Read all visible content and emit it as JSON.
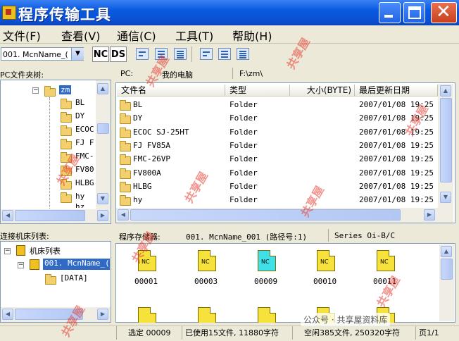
{
  "window": {
    "title": "程序传输工具"
  },
  "menu": [
    "文件(F)",
    "查看(V)",
    "通信(C)",
    "工具(T)",
    "帮助(H)"
  ],
  "toolbar": {
    "machine_combo": "001. McnName_(",
    "nc_label": "NC",
    "ds_label": "DS"
  },
  "pc_pane": {
    "header": "PC文件夹树:",
    "tree_root": "zm",
    "tree_items": [
      "BL",
      "DY",
      "ECOC",
      "FJ F",
      "FMC-",
      "FV80",
      "HLBG",
      "hy",
      "hz"
    ]
  },
  "file_pane": {
    "location_label": "PC:",
    "location_name": "我的电脑",
    "path": "F:\\zm\\",
    "columns": [
      "文件名",
      "类型",
      "大小(BYTE)",
      "最后更新日期"
    ],
    "rows": [
      {
        "name": "BL",
        "type": "Folder",
        "size": "",
        "date": "2007/01/08 19:25"
      },
      {
        "name": "DY",
        "type": "Folder",
        "size": "",
        "date": "2007/01/08 19:25"
      },
      {
        "name": "ECOC SJ-25HT",
        "type": "Folder",
        "size": "",
        "date": "2007/01/08 19:25"
      },
      {
        "name": "FJ FV85A",
        "type": "Folder",
        "size": "",
        "date": "2007/01/08 19:25"
      },
      {
        "name": "FMC-26VP",
        "type": "Folder",
        "size": "",
        "date": "2007/01/08 19:25"
      },
      {
        "name": "FV800A",
        "type": "Folder",
        "size": "",
        "date": "2007/01/08 19:25"
      },
      {
        "name": "HLBG",
        "type": "Folder",
        "size": "",
        "date": "2007/01/08 19:25"
      },
      {
        "name": "hy",
        "type": "Folder",
        "size": "",
        "date": "2007/01/08 19:25"
      }
    ]
  },
  "machine_pane": {
    "header": "连接机床列表:",
    "root": "机床列表",
    "machine": "001. McnName_(",
    "data_node": "[DATA]"
  },
  "storage_pane": {
    "label": "程序存储器:",
    "machine": "001. McnName_001 (路径号:1)",
    "series": "Series Oi-B/C",
    "files": [
      {
        "name": "00001",
        "icon_text": "NC",
        "color": "#f6e23a"
      },
      {
        "name": "00003",
        "icon_text": "NC",
        "color": "#f6e23a"
      },
      {
        "name": "00009",
        "icon_text": "NC",
        "color": "#40e0e8"
      },
      {
        "name": "00010",
        "icon_text": "NC",
        "color": "#f6e23a"
      },
      {
        "name": "00011",
        "icon_text": "NC",
        "color": "#f6e23a"
      }
    ]
  },
  "status": {
    "selected": "选定 00009",
    "used": "已使用15文件, 11880字符",
    "free": "空闲385文件, 250320字符",
    "page": "页1/1"
  },
  "watermark": {
    "text": "共享屋",
    "footer": "公众号 · 共享屋资料库"
  }
}
